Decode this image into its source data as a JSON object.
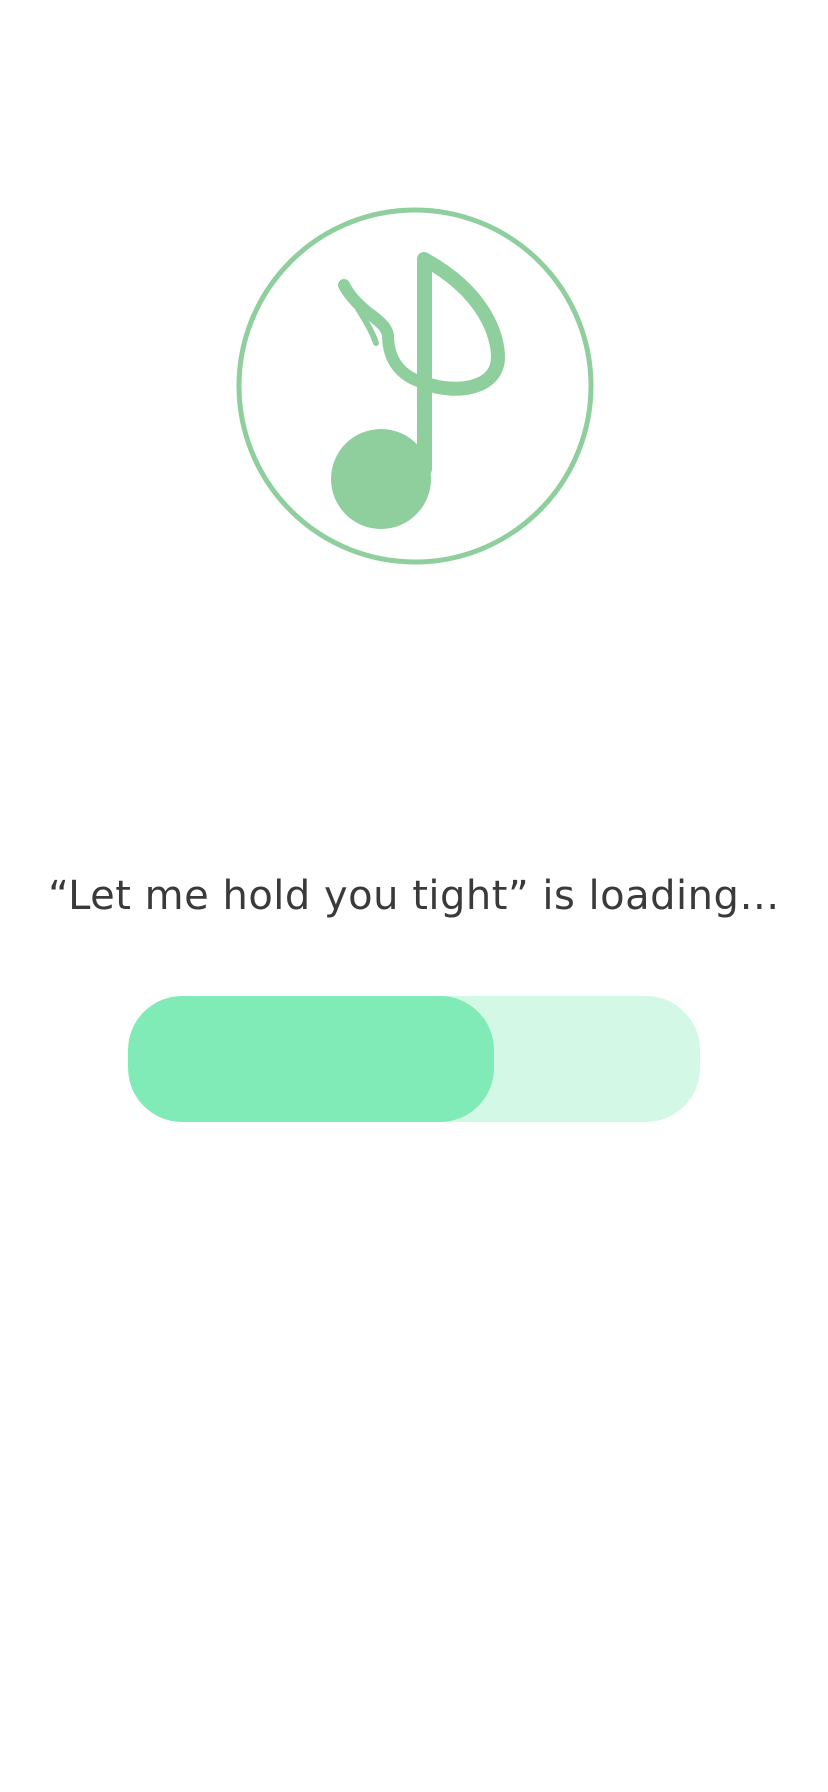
{
  "app": {
    "logo_icon": "music-note-icon",
    "logo_color": "#8fcf9e"
  },
  "loading": {
    "text": "“Let me hold you tight” is loading…"
  },
  "progress": {
    "fraction": 0.64,
    "track_color": "#d4f8e6",
    "fill_color": "#80ebb7"
  }
}
